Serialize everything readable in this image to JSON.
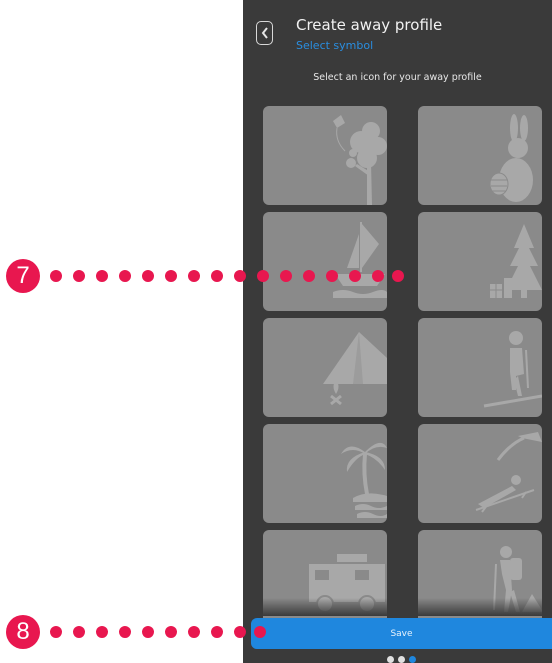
{
  "header": {
    "title": "Create away profile",
    "subtitle": "Select symbol",
    "back_icon": "chevron-left-icon"
  },
  "instruction": "Select an icon for your away profile",
  "symbols": [
    {
      "name": "kite-tree"
    },
    {
      "name": "easter-bunny"
    },
    {
      "name": "sailboat"
    },
    {
      "name": "christmas-tree"
    },
    {
      "name": "camping-tent"
    },
    {
      "name": "skier"
    },
    {
      "name": "palm-island"
    },
    {
      "name": "beach-lounger"
    },
    {
      "name": "camper-van"
    },
    {
      "name": "hiker"
    }
  ],
  "save_label": "Save",
  "pagination": {
    "total": 3,
    "active": 3
  },
  "callouts": [
    {
      "number": "7"
    },
    {
      "number": "8"
    }
  ],
  "colors": {
    "background": "#3a3a3a",
    "tile": "#8a8a8a",
    "accent": "#1f87de",
    "callout": "#e8174f"
  }
}
